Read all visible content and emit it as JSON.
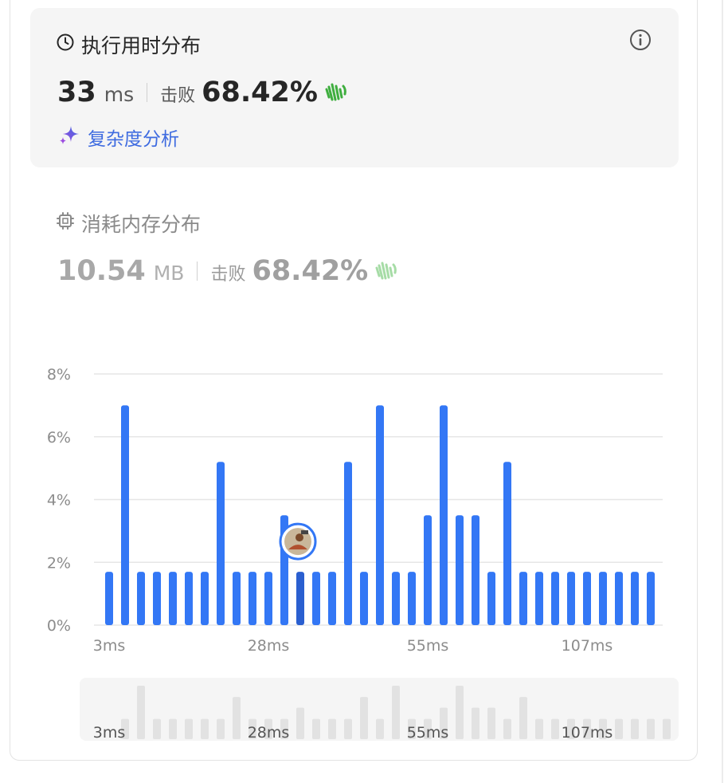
{
  "runtime": {
    "title": "执行用时分布",
    "value": "33",
    "unit": "ms",
    "beat_label": "击败",
    "beat_percent": "68.42%",
    "complexity_link": "复杂度分析"
  },
  "memory": {
    "title": "消耗内存分布",
    "value": "10.54",
    "unit": "MB",
    "beat_label": "击败",
    "beat_percent": "68.42%"
  },
  "colors": {
    "bar": "#3377f5",
    "bar_highlight": "#2a5fd0",
    "mini_bar": "#e2e2e2",
    "grid": "#e6e6e6",
    "clap": "#3fae3f",
    "clap_muted": "#a6dca6"
  },
  "icons": {
    "runtime": "clock-icon",
    "memory": "chip-icon",
    "info": "info-icon",
    "complexity": "sparkle-icon",
    "clap": "clapping-hands-icon",
    "marker": "user-avatar-marker"
  },
  "chart_data": {
    "type": "bar",
    "ylabel_ticks": [
      "0%",
      "2%",
      "4%",
      "6%",
      "8%"
    ],
    "ylim": [
      0,
      8
    ],
    "x_tick_labels": [
      "3ms",
      "28ms",
      "55ms",
      "107ms"
    ],
    "x_tick_indices": [
      0,
      10,
      20,
      30
    ],
    "values": [
      1.7,
      7.0,
      1.7,
      1.7,
      1.7,
      1.7,
      1.7,
      5.2,
      1.7,
      1.7,
      1.7,
      3.5,
      1.7,
      1.7,
      1.7,
      5.2,
      1.7,
      7.0,
      1.7,
      1.7,
      3.5,
      7.0,
      3.5,
      3.5,
      1.7,
      5.2,
      1.7,
      1.7,
      1.7,
      1.7,
      1.7,
      1.7,
      1.7,
      1.7,
      1.7
    ],
    "highlight_index": 12,
    "marker_index": 12,
    "grid": true
  }
}
